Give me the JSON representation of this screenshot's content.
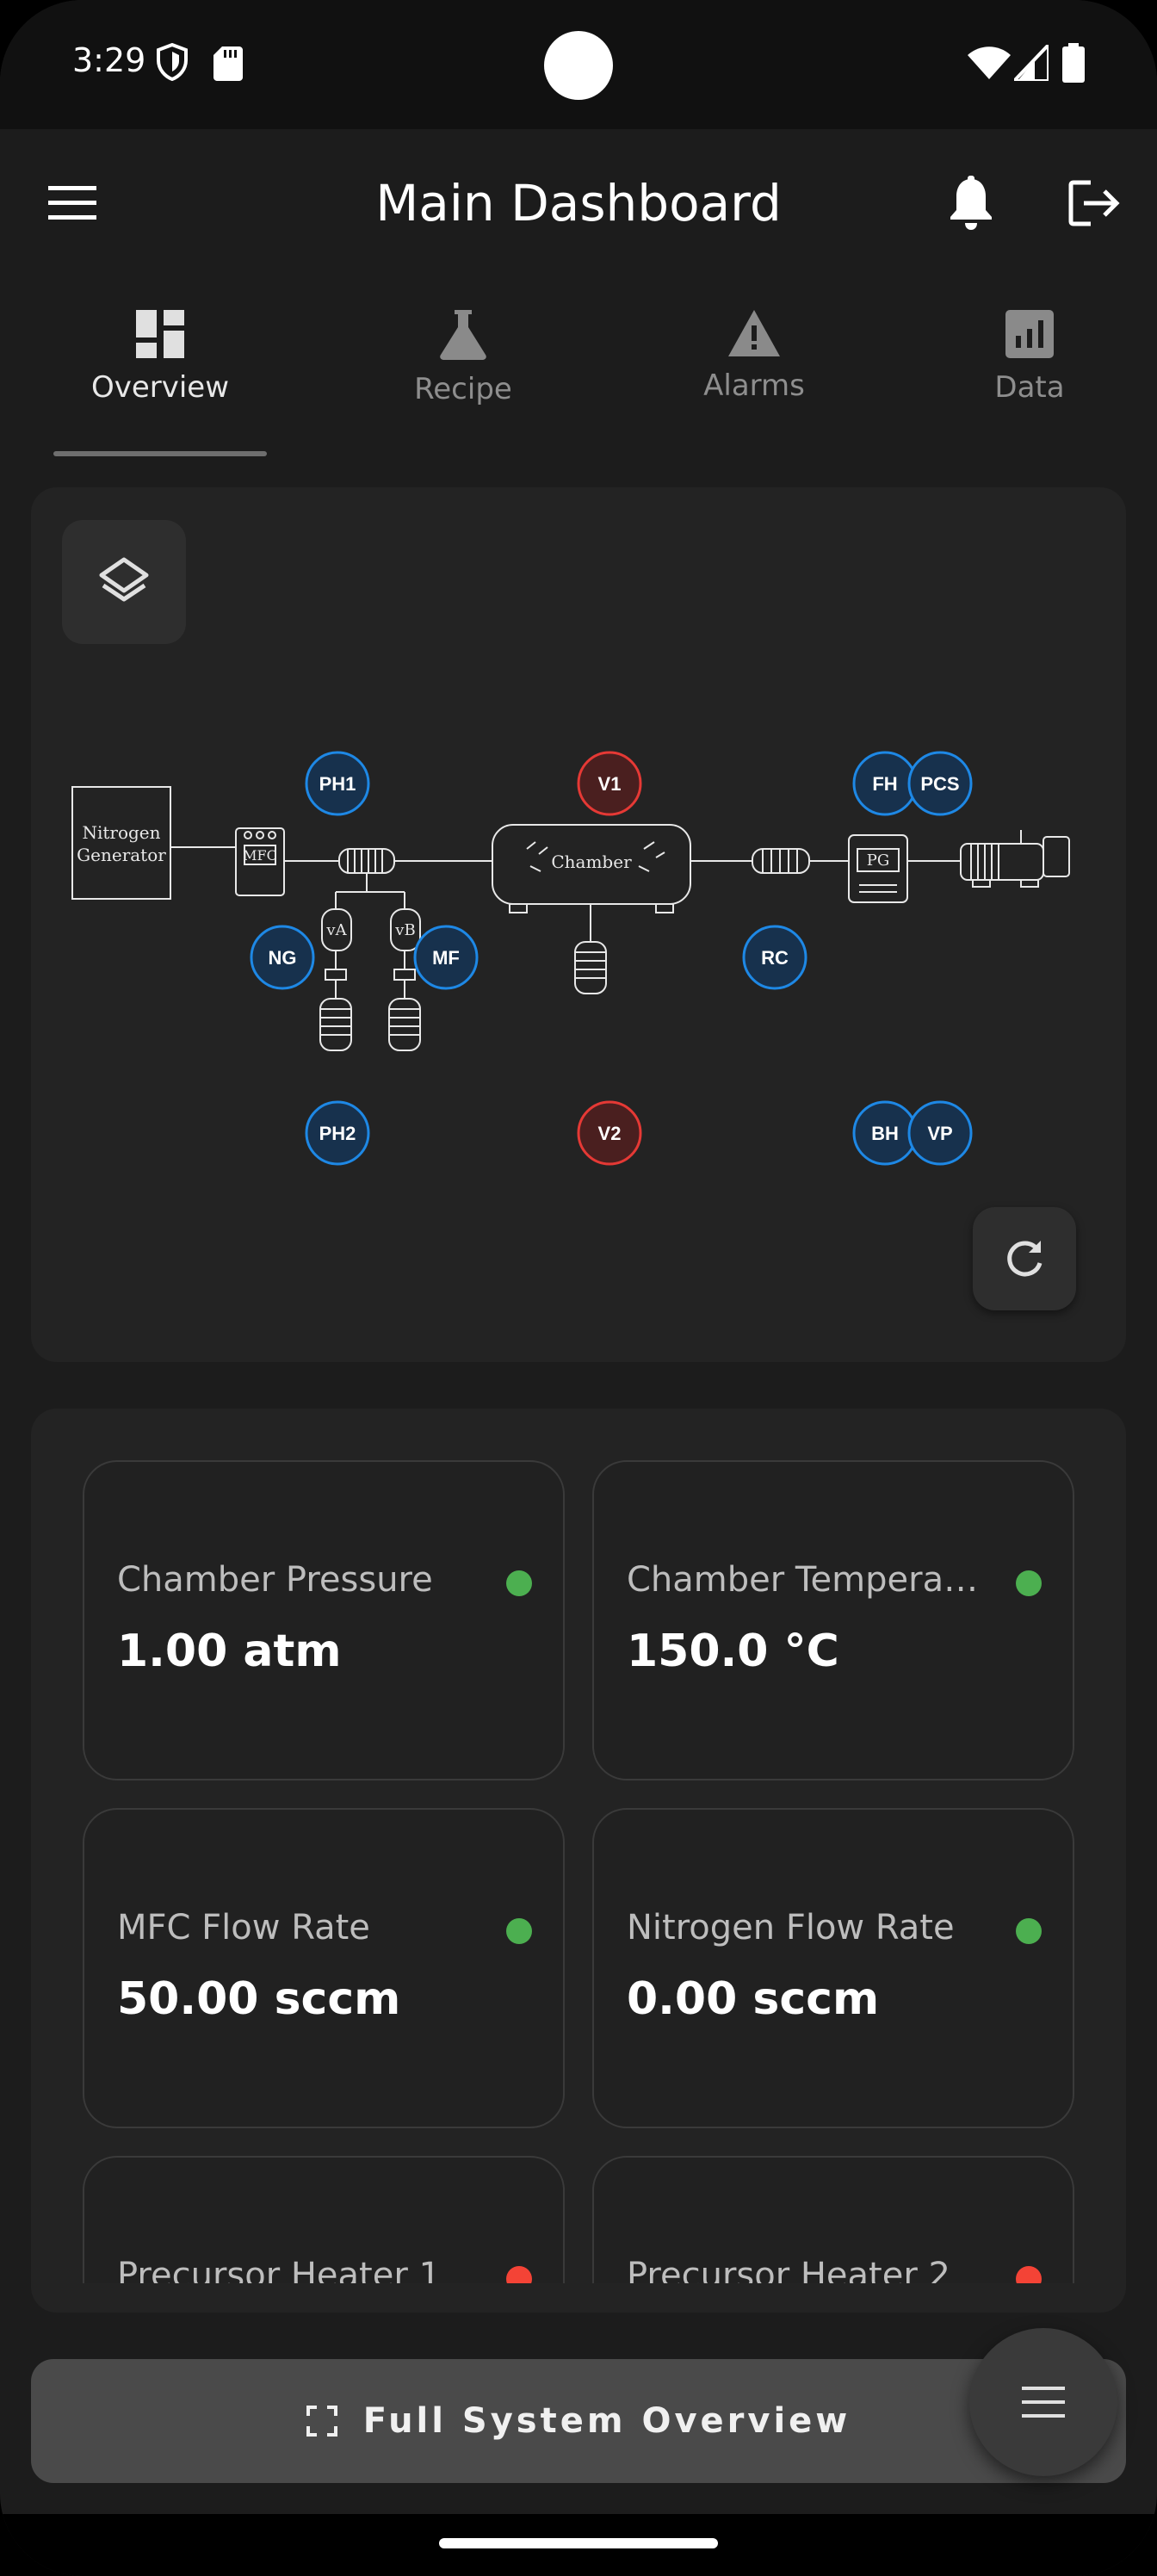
{
  "status_bar": {
    "time": "3:29"
  },
  "app_bar": {
    "title": "Main Dashboard"
  },
  "tabs": [
    {
      "label": "Overview",
      "icon": "dashboard-icon",
      "active": true
    },
    {
      "label": "Recipe",
      "icon": "flask-icon",
      "active": false
    },
    {
      "label": "Alarms",
      "icon": "warning-icon",
      "active": false
    },
    {
      "label": "Data",
      "icon": "bar-chart-icon",
      "active": false
    }
  ],
  "diagram": {
    "nitrogen_generator": [
      "Nitrogen",
      "Generator"
    ],
    "mfc": "MFC",
    "chamber": "Chamber",
    "pg": "PG",
    "vessel_a": "vA",
    "vessel_b": "vB",
    "nodes": {
      "ph1": "PH1",
      "v1": "V1",
      "fh": "FH",
      "pcs": "PCS",
      "ng": "NG",
      "mf": "MF",
      "rc": "RC",
      "ph2": "PH2",
      "v2": "V2",
      "bh": "BH",
      "vp": "VP"
    },
    "colors": {
      "node_blue": "#1e88e5",
      "node_blue_fill": "#17314d",
      "node_red": "#e53935",
      "node_red_fill": "#4a1f1f"
    }
  },
  "metrics": [
    {
      "label": "Chamber Pressure",
      "value": "1.00 atm",
      "status": "green"
    },
    {
      "label": "Chamber Temperatu...",
      "value": "150.0 °C",
      "status": "green"
    },
    {
      "label": "MFC Flow Rate",
      "value": "50.00 sccm",
      "status": "green"
    },
    {
      "label": "Nitrogen Flow Rate",
      "value": "0.00 sccm",
      "status": "green"
    },
    {
      "label": "Precursor Heater 1",
      "value": "",
      "status": "red"
    },
    {
      "label": "Precursor Heater 2",
      "value": "",
      "status": "red"
    }
  ],
  "bottom": {
    "full_overview_label": "Full System Overview"
  },
  "colors": {
    "status_green": "#4caf50",
    "status_red": "#f44336",
    "background": "#1c1c1c",
    "card": "#232323"
  }
}
